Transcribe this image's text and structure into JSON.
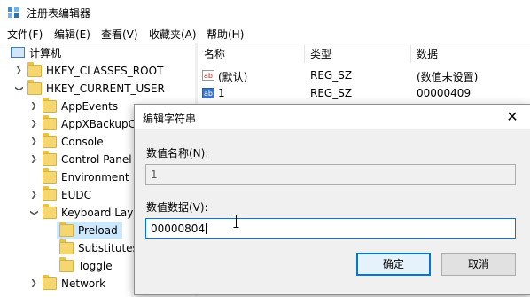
{
  "window": {
    "title": "注册表编辑器"
  },
  "menu": [
    "文件(F)",
    "编辑(E)",
    "查看(V)",
    "收藏夹(A)",
    "帮助(H)"
  ],
  "tree": {
    "root": "计算机",
    "hkcr": "HKEY_CLASSES_ROOT",
    "hkcu": "HKEY_CURRENT_USER",
    "children": [
      "AppEvents",
      "AppXBackupC",
      "Console",
      "Control Panel",
      "Environment",
      "EUDC",
      "Keyboard Lay"
    ],
    "keyboard_children": [
      "Preload",
      "Substitutes",
      "Toggle"
    ],
    "after": "Network"
  },
  "list": {
    "headers": [
      "名称",
      "类型",
      "数据"
    ],
    "rows": [
      {
        "name": "(默认)",
        "type": "REG_SZ",
        "data": "(数值未设置)"
      },
      {
        "name": "1",
        "type": "REG_SZ",
        "data": "00000409"
      }
    ]
  },
  "dialog": {
    "title": "编辑字符串",
    "name_label": "数值名称(N):",
    "name_value": "1",
    "data_label": "数值数据(V):",
    "data_value": "00000804",
    "ok": "确定",
    "cancel": "取消"
  },
  "colors": {
    "accent": "#0078d7",
    "selection": "#cce8ff",
    "folder": "#f6d66f"
  },
  "icons": [
    "regedit-icon",
    "computer-icon",
    "folder-icon",
    "string-value-icon",
    "close-icon",
    "ibeam-cursor-icon"
  ]
}
